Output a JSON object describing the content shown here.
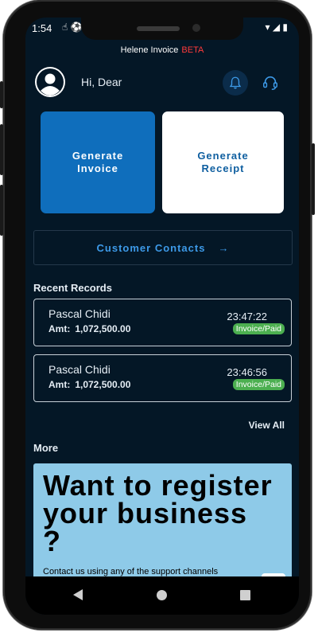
{
  "status_bar": {
    "time": "1:54",
    "left_icons": "☝ ⚽",
    "right_icons": "▾ ◢ ▮"
  },
  "app": {
    "title": "Helene Invoice",
    "badge": "BETA"
  },
  "header": {
    "greeting": "Hi, Dear"
  },
  "actions": {
    "generate_invoice": "Generate Invoice",
    "generate_receipt": "Generate Receipt"
  },
  "contacts": {
    "label": "Customer Contacts",
    "arrow": "→"
  },
  "recent": {
    "title": "Recent Records",
    "records": [
      {
        "name": "Pascal Chidi",
        "amount_label": "Amt:",
        "amount": "1,072,500.00",
        "time": "23:47:22",
        "status": "Invoice/Paid"
      },
      {
        "name": "Pascal Chidi",
        "amount_label": "Amt:",
        "amount": "1,072,500.00",
        "time": "23:46:56",
        "status": "Invoice/Paid"
      }
    ],
    "view_all": "View All"
  },
  "more": {
    "title": "More",
    "banner_title": "Want to register your business ?",
    "banner_text": "Contact us using any of the support channels"
  },
  "colors": {
    "background": "#041726",
    "primary": "#0f6ebc",
    "accent": "#3d9ae8",
    "status_paid": "#4caf50",
    "banner": "#8ecae8",
    "beta": "#ff3b3b"
  }
}
